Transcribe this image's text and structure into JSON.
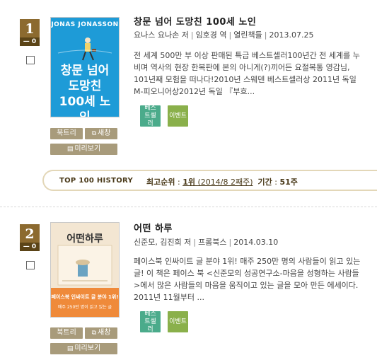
{
  "books": [
    {
      "rank": "1",
      "rank_change": "— 0",
      "title": "창문 넘어 도망친 100세 노인",
      "author": "요나스 요나손 저",
      "translator": "임호경 역",
      "publisher": "열린책들",
      "date": "2013.07.25",
      "description": "전 세계 500만 부 이상 판매된 특급 베스트셀러100년간 전 세계를 누비며 역사의 현장 한복판에 본의 아니게(?)끼어든 요절복통 영감님, 101년째 모험을 떠나다!2010년 스웨덴 베스트셀러상 2011년 독일 M-피오니어상2012년 독일 『부흐...",
      "cover": {
        "author_text": "JONAS JONASSON",
        "title_text": "창문 넘어 도망친 100세 노인",
        "bg_color": "#1e9bd7"
      },
      "buttons": {
        "booktree": "북트리",
        "new_window": "새창",
        "preview": "미리보기"
      },
      "badges": {
        "bestseller": "베스트셀러",
        "event": "이벤트"
      }
    },
    {
      "rank": "2",
      "rank_change": "— 0",
      "title": "어떤 하루",
      "author": "신준모, 김진희 저",
      "publisher": "프롬북스",
      "date": "2014.03.10",
      "description": "페이스북 인싸이트 글 분야 1위! 매주 250만 명의 사람들이 읽고 있는 글! 이 책은 페이스 북 <신준모의 성공연구소-마음을 성형하는 사람들>에서 많은 사람들의 마음을 움직이고 있는 글을 모아 만든 에세이다. 2011년 11월부터 ...",
      "cover": {
        "title_text": "어떤하루",
        "banner_text": "페이스북 인싸이트 글 분야 1위!",
        "banner_sub": "매주 250만 명이 읽고 있는 글",
        "bg_color": "#ef8a3a"
      },
      "buttons": {
        "booktree": "북트리",
        "new_window": "새창",
        "preview": "미리보기"
      },
      "badges": {
        "bestseller": "베스트셀러",
        "event": "이벤트"
      }
    }
  ],
  "history": {
    "title": "TOP 100 HISTORY",
    "best_rank_label": "최고순위",
    "best_rank_value": "1위",
    "best_rank_date": "(2014/8 2째주)",
    "period_label": "기간",
    "period_value": "51주"
  },
  "colors": {
    "rank_bg": "#8c6a2f",
    "button_bg": "#a89b7b",
    "badge_best": "#4bab8b",
    "badge_event": "#8ab04b"
  }
}
